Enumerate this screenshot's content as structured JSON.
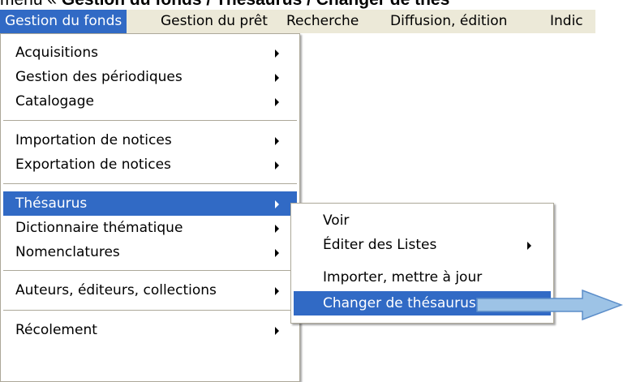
{
  "caption": {
    "prefix": "menu « ",
    "bold": "Gestion du fonds / Thésaurus / Changer de thés"
  },
  "menubar": {
    "items": [
      "Gestion du fonds",
      "Gestion du prêt",
      "Recherche",
      "Diffusion, édition",
      "Indic"
    ]
  },
  "menu": {
    "items": [
      {
        "label": "Acquisitions"
      },
      {
        "label": "Gestion des périodiques"
      },
      {
        "label": "Catalogage"
      },
      {
        "label": "Importation de notices"
      },
      {
        "label": "Exportation de notices"
      },
      {
        "label": "Thésaurus"
      },
      {
        "label": "Dictionnaire thématique"
      },
      {
        "label": "Nomenclatures"
      },
      {
        "label": "Auteurs, éditeurs, collections"
      },
      {
        "label": "Récolement"
      }
    ]
  },
  "submenu": {
    "items": [
      {
        "label": "Voir"
      },
      {
        "label": "Éditer des Listes"
      },
      {
        "label": "Importer, mettre à jour"
      },
      {
        "label": "Changer de thésaurus"
      }
    ]
  },
  "colors": {
    "highlight": "#316ac5",
    "menubar": "#ece9d8",
    "arrow_fill": "#9dc3e6",
    "arrow_stroke": "#5b8dc9"
  }
}
